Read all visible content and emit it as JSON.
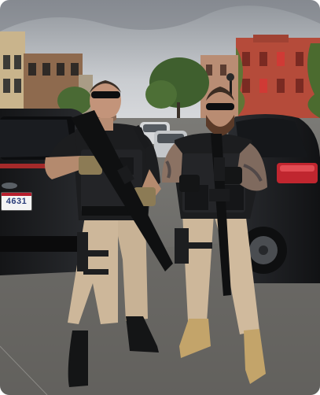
{
  "photo": {
    "subject": "two-armed-men-in-tactical-vests",
    "license_plate": "4631",
    "colors": {
      "sky": "#b9bcc0",
      "asphalt": "#6e6d6a",
      "vest": "#1c1d1f",
      "pants": "#cdb79a",
      "brick": "#b54b3a",
      "foliage": "#3d5b2c",
      "car": "#1a1b1d"
    }
  }
}
